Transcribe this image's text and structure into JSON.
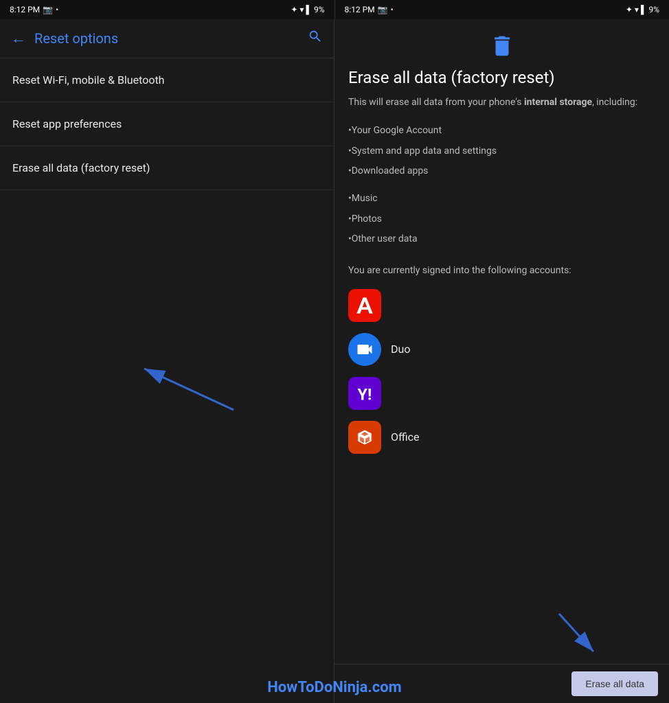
{
  "status_bar": {
    "left": {
      "time": "8:12 PM",
      "battery": "9%"
    },
    "right": {
      "time": "8:12 PM",
      "battery": "9%"
    }
  },
  "left_panel": {
    "title": "Reset options",
    "items": [
      {
        "label": "Reset Wi-Fi, mobile & Bluetooth"
      },
      {
        "label": "Reset app preferences"
      },
      {
        "label": "Erase all data (factory reset)"
      }
    ]
  },
  "right_panel": {
    "title": "Erase all data (factory reset)",
    "description_prefix": "This will erase all data from your phone's ",
    "description_bold": "internal storage",
    "description_suffix": ", including:",
    "bullets": [
      "•Your Google Account",
      "•System and app data and settings",
      "•Downloaded apps",
      "•Music",
      "•Photos",
      "•Other user data"
    ],
    "accounts_label": "You are currently signed into the following accounts:",
    "apps": [
      {
        "name": "Adobe",
        "label": ""
      },
      {
        "name": "Duo",
        "label": "Duo"
      },
      {
        "name": "Yahoo",
        "label": ""
      },
      {
        "name": "Office",
        "label": "Office"
      }
    ],
    "erase_button": "Erase all data"
  },
  "watermark": "HowToDoNinja.com"
}
